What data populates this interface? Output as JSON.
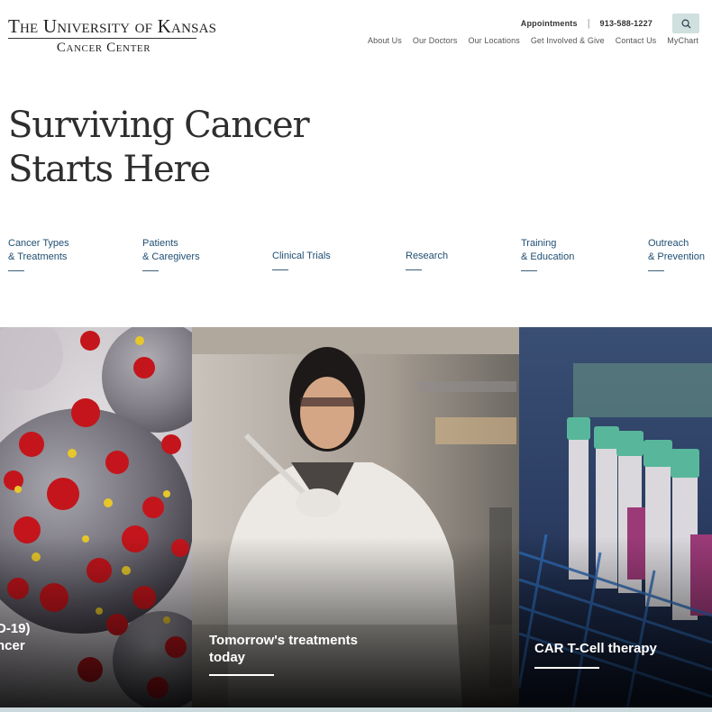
{
  "logo": {
    "line1": "The University of Kansas",
    "line2": "Cancer Center"
  },
  "utility": {
    "appointments": "Appointments",
    "separator": "|",
    "phone": "913-588-1227",
    "search_icon": "search-icon"
  },
  "nav": [
    "About Us",
    "Our Doctors",
    "Our Locations",
    "Get Involved & Give",
    "Contact Us",
    "MyChart"
  ],
  "hero": {
    "title": "Surviving Cancer Starts Here"
  },
  "categories": [
    {
      "line1": "Cancer Types",
      "line2": "& Treatments"
    },
    {
      "line1": "Patients",
      "line2": "& Caregivers"
    },
    {
      "line1": "Clinical Trials",
      "line2": ""
    },
    {
      "line1": "Research",
      "line2": ""
    },
    {
      "line1": "Training",
      "line2": "& Education"
    },
    {
      "line1": "Outreach",
      "line2": "& Prevention"
    }
  ],
  "tiles": [
    {
      "line1": "D-19)",
      "line2": "ncer"
    },
    {
      "line1": "Tomorrow's treatments",
      "line2": "today"
    },
    {
      "line1": "CAR T-Cell therapy",
      "line2": ""
    }
  ],
  "colors": {
    "link_blue": "#1f4e72",
    "search_bg": "#cfe0de",
    "strip": "#cbd9dd"
  }
}
